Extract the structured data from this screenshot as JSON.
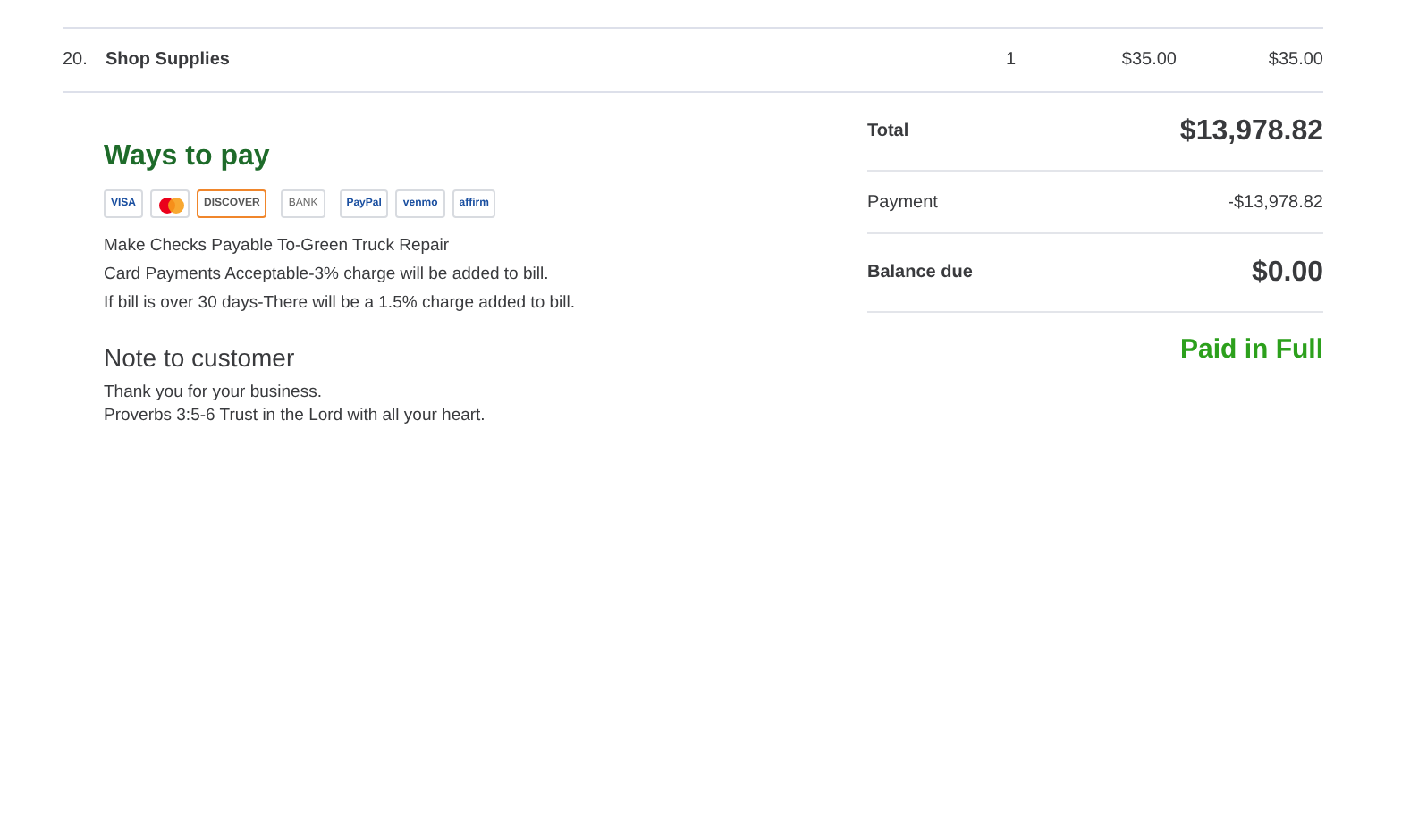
{
  "line_items": [
    {
      "number": "20.",
      "name": "Shop Supplies",
      "qty": "1",
      "rate": "$35.00",
      "amount": "$35.00"
    }
  ],
  "ways_to_pay": {
    "title": "Ways to pay",
    "methods": [
      {
        "kind": "word",
        "label": "VISA"
      },
      {
        "kind": "circles"
      },
      {
        "kind": "word",
        "label": "DISCOVER"
      },
      {
        "kind": "word",
        "label": "BANK"
      },
      {
        "kind": "word",
        "label": "PayPal"
      },
      {
        "kind": "word",
        "label": "venmo"
      },
      {
        "kind": "word",
        "label": "affirm"
      }
    ],
    "lines": [
      "Make Checks Payable To-Green Truck Repair",
      "Card Payments Acceptable-3% charge will be added to bill.",
      "If bill is over 30 days-There will be a 1.5% charge added to bill."
    ]
  },
  "note": {
    "title": "Note to customer",
    "lines": [
      "Thank you for your business.",
      "Proverbs 3:5-6 Trust in the Lord with all your heart."
    ]
  },
  "summary": [
    {
      "kind": "major",
      "label": "Total",
      "value": "$13,978.82"
    },
    {
      "kind": "minor",
      "label": "Payment",
      "value": "-$13,978.82"
    },
    {
      "kind": "major",
      "label": "Balance due",
      "value": "$0.00"
    }
  ],
  "status": "Paid in Full"
}
